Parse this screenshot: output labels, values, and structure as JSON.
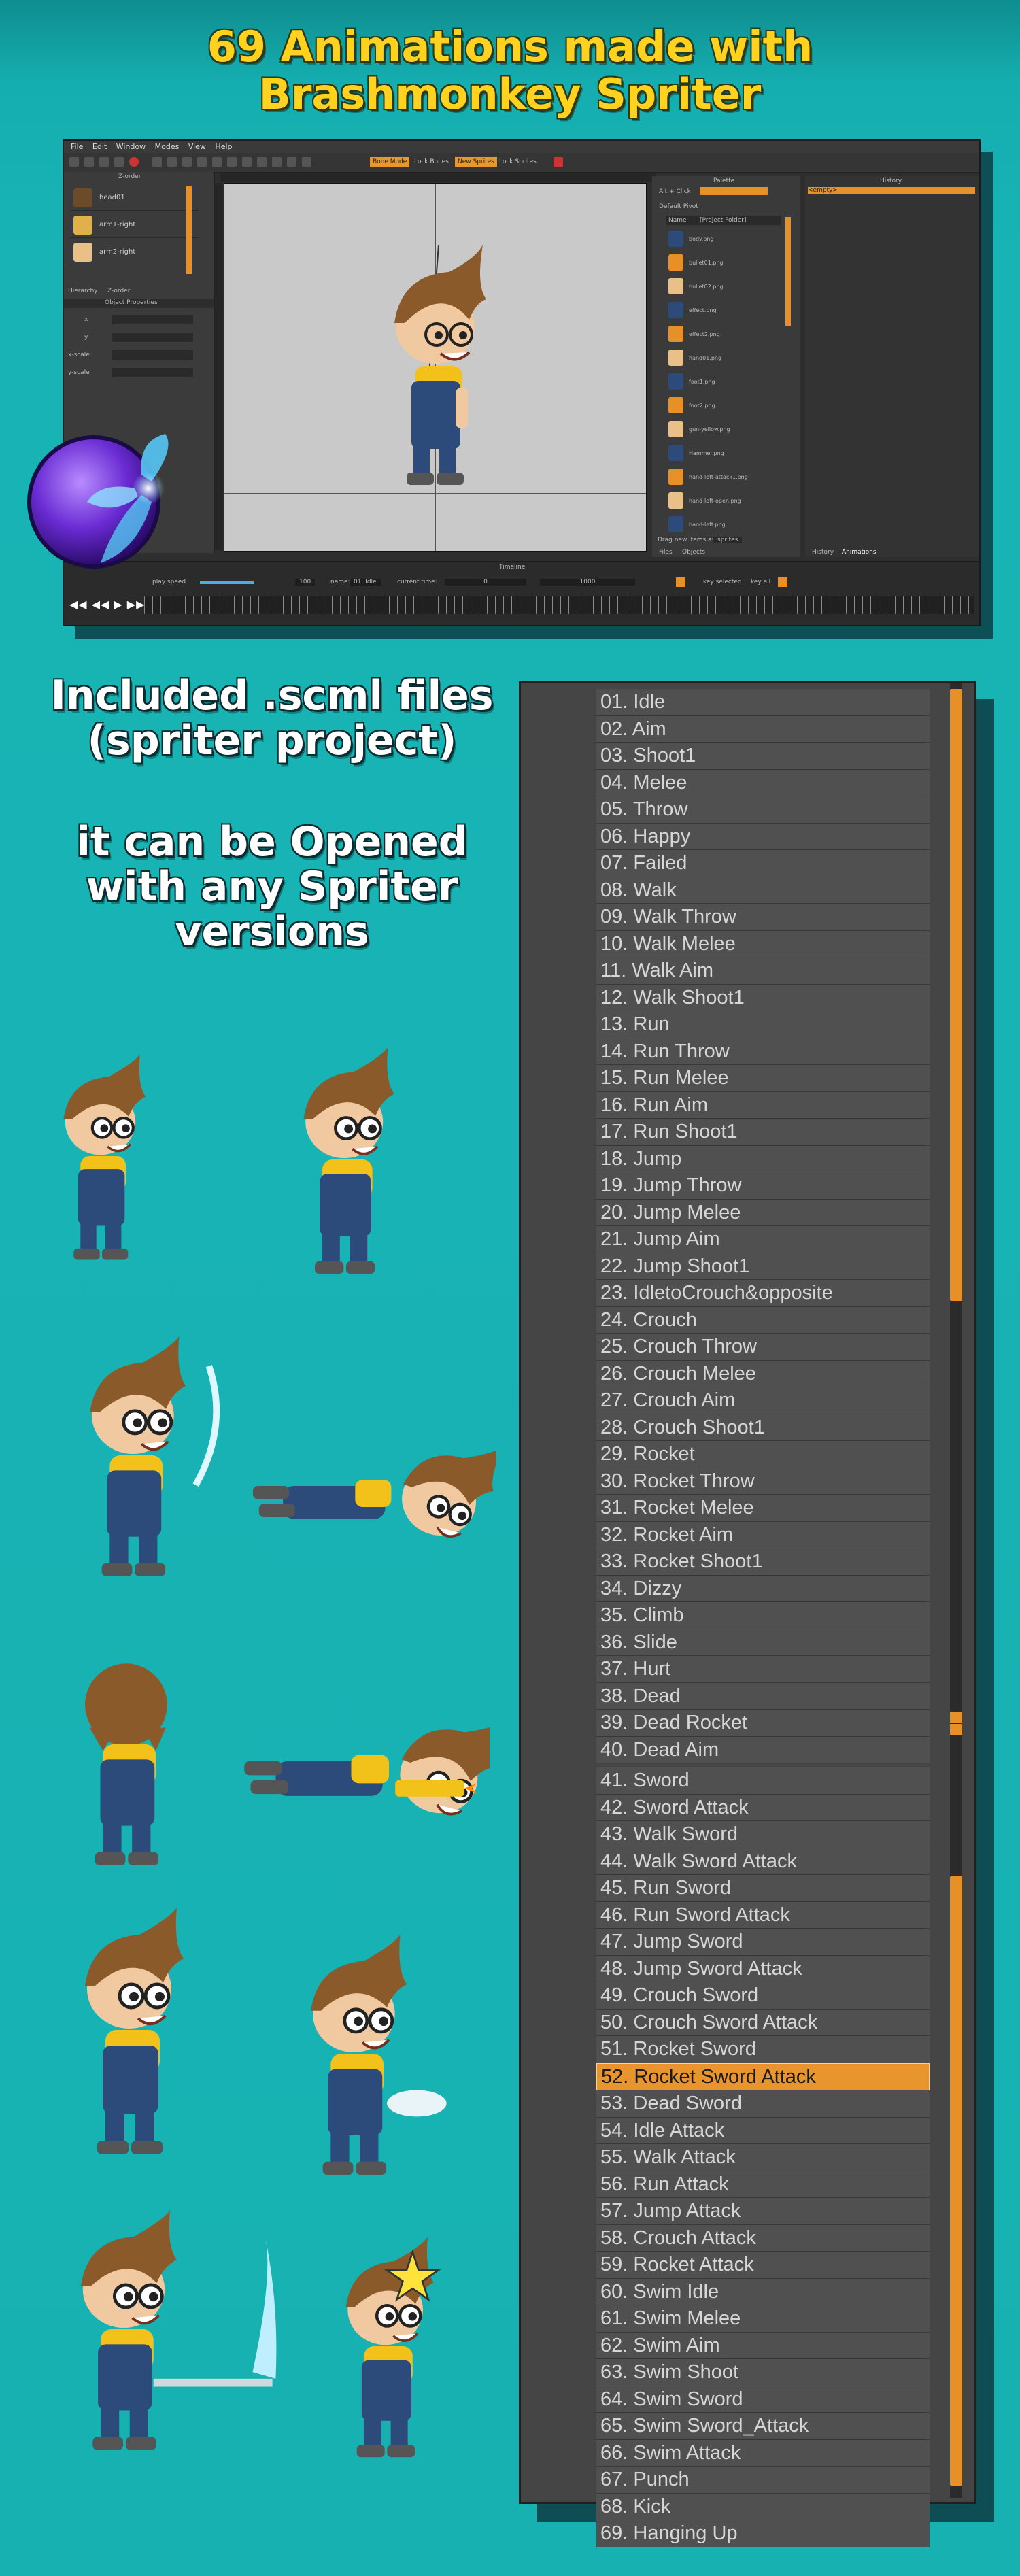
{
  "title": {
    "line1": "69 Animations made with",
    "line2": "Brashmonkey Spriter"
  },
  "spriter": {
    "menu": [
      "File",
      "Edit",
      "Window",
      "Modes",
      "View",
      "Help"
    ],
    "toolbar": {
      "mode1": "Bone Mode",
      "lock_bones": "Lock Bones",
      "mode2": "New Sprites",
      "lock_sprites": "Lock Sprites"
    },
    "hierarchy": {
      "header": "Z-order",
      "items": [
        "head01",
        "arm1-right",
        "arm2-right"
      ],
      "tabs": [
        "Hierarchy",
        "Z-order"
      ]
    },
    "object_properties": {
      "header": "Object Properties",
      "fields": [
        "x",
        "y",
        "x-scale",
        "y-scale"
      ]
    },
    "palette": {
      "header": "Palette",
      "alt_click": "Alt + Click",
      "default_pivot": "Default Pivot",
      "col_name": "Name",
      "col_folder": "[Project Folder]",
      "files": [
        "body.png",
        "bullet01.png",
        "bullet02.png",
        "effect.png",
        "effect2.png",
        "hand01.png",
        "foot1.png",
        "foot2.png",
        "gun-yellow.png",
        "Hammer.png",
        "hand-left-attack1.png",
        "hand-left-open.png",
        "hand-left.png"
      ],
      "drag_hint": "Drag new items as",
      "drag_option": "sprites",
      "tabs": [
        "Files",
        "Objects"
      ]
    },
    "history": {
      "header": "History",
      "first": "<empty>",
      "tabs": [
        "History",
        "Animations"
      ]
    },
    "timeline": {
      "header": "Timeline",
      "play_speed": "play speed",
      "speed_value": "100",
      "name_label": "name:",
      "name_value": "01. Idle",
      "current_time_label": "current time:",
      "current_time": "0",
      "length": "1000",
      "key_selected": "key selected",
      "key_all": "key all"
    }
  },
  "left_texts": {
    "scml_line1": "Included .scml files",
    "scml_line2": "(spriter project)",
    "open_line1": "it can be Opened",
    "open_line2": "with any Spriter",
    "open_line3": "versions"
  },
  "animations": {
    "selected_index": 51,
    "items": [
      "01. Idle",
      "02. Aim",
      "03. Shoot1",
      "04. Melee",
      "05. Throw",
      "06. Happy",
      "07. Failed",
      "08. Walk",
      "09. Walk Throw",
      "10. Walk Melee",
      "11. Walk Aim",
      "12. Walk Shoot1",
      "13. Run",
      "14. Run Throw",
      "15. Run Melee",
      "16. Run Aim",
      "17. Run Shoot1",
      "18. Jump",
      "19. Jump Throw",
      "20. Jump Melee",
      "21. Jump Aim",
      "22. Jump Shoot1",
      "23. IdletoCrouch&opposite",
      "24. Crouch",
      "25. Crouch Throw",
      "26. Crouch Melee",
      "27. Crouch Aim",
      "28. Crouch Shoot1",
      "29. Rocket",
      "30. Rocket Throw",
      "31. Rocket Melee",
      "32. Rocket Aim",
      "33. Rocket Shoot1",
      "34. Dizzy",
      "35. Climb",
      "36. Slide",
      "37. Hurt",
      "38. Dead",
      "39. Dead Rocket",
      "40. Dead Aim",
      "41. Sword",
      "42. Sword Attack",
      "43. Walk Sword",
      "44. Walk Sword Attack",
      "45. Run Sword",
      "46. Run Sword Attack",
      "47. Jump Sword",
      "48. Jump Sword Attack",
      "49. Crouch Sword",
      "50. Crouch Sword Attack",
      "51. Rocket Sword",
      "52. Rocket Sword Attack",
      "53. Dead Sword",
      "54. Idle Attack",
      "55. Walk Attack",
      "56. Run Attack",
      "57. Jump Attack",
      "58. Crouch Attack",
      "59. Rocket Attack",
      "60. Swim Idle",
      "61. Swim Melee",
      "62. Swim Aim",
      "63. Swim Shoot",
      "64. Swim Sword",
      "65. Swim Sword_Attack",
      "66. Swim Attack",
      "67. Punch",
      "68. Kick",
      "69. Hanging Up"
    ]
  },
  "colors": {
    "accent": "#e8952d",
    "title_yellow": "#ffd21f",
    "background_teal": "#17b1b2",
    "hair": "#8b5a2b",
    "shirt": "#f2c21a",
    "overalls": "#2c4a7a"
  },
  "poses": [
    "idle",
    "jump",
    "melee",
    "rocket-fly",
    "climb-back",
    "rocket-shoot",
    "run",
    "rocket-sword",
    "sword-attack",
    "dizzy"
  ]
}
